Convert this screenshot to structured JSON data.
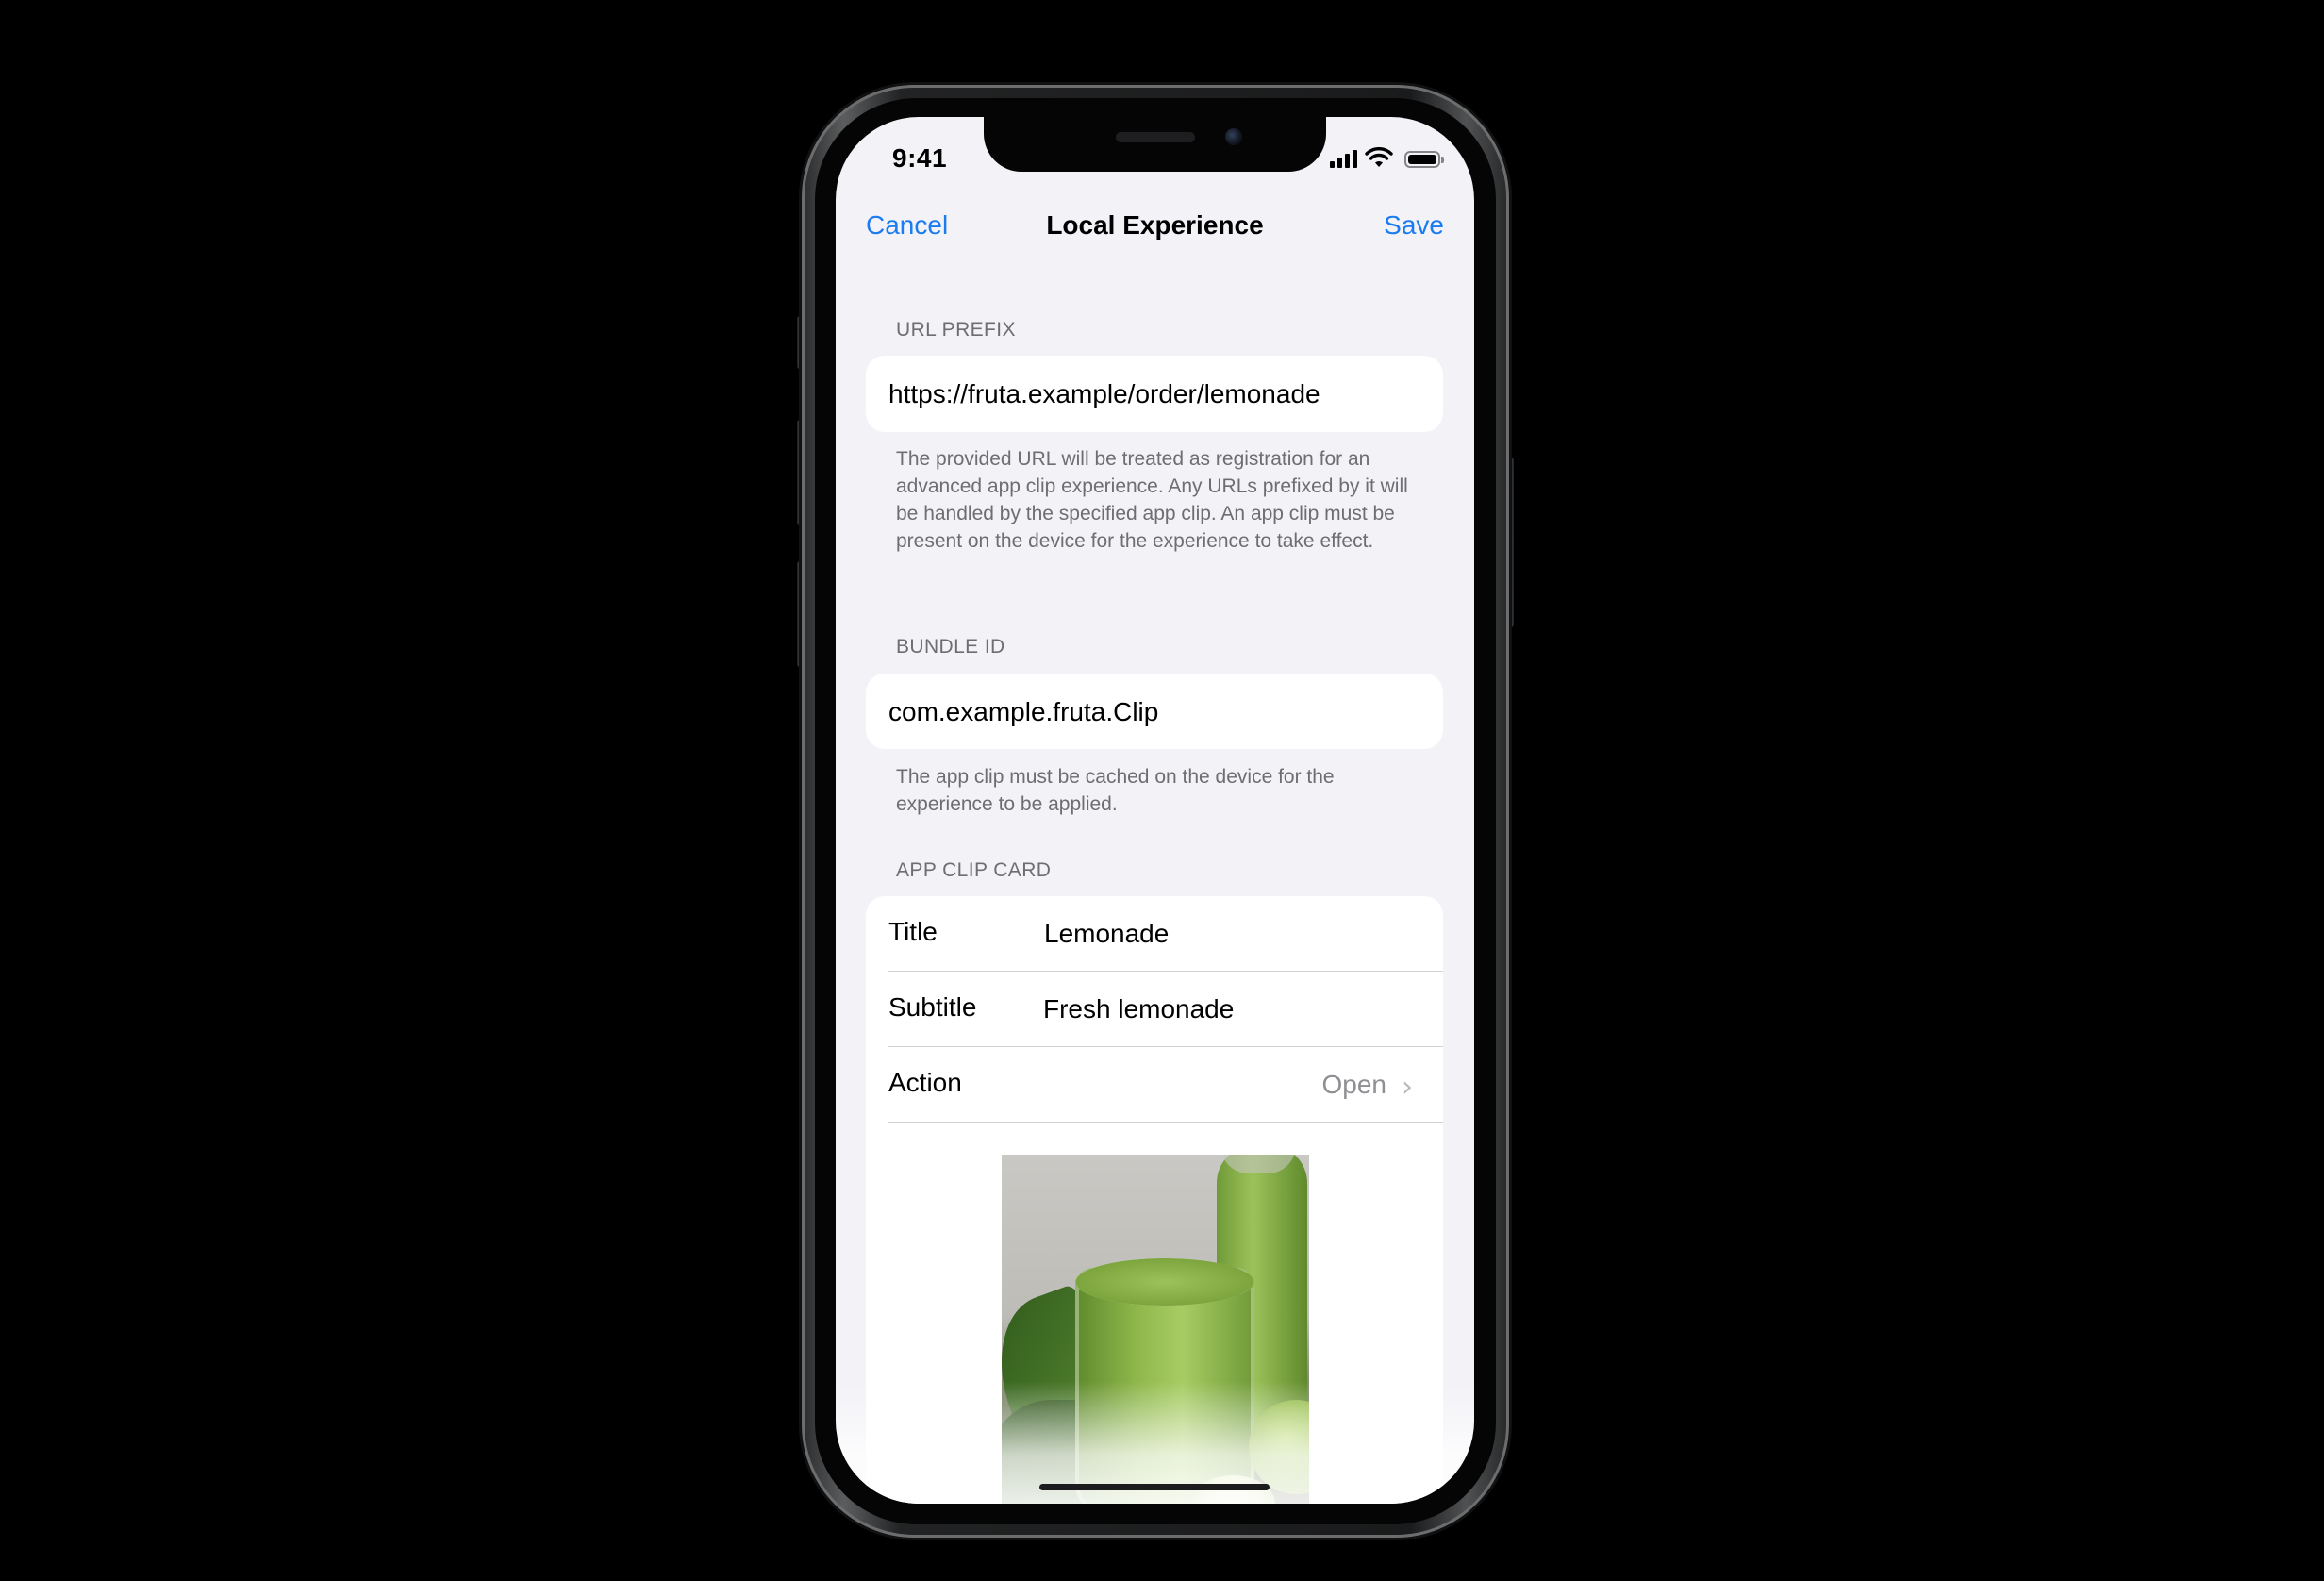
{
  "status_bar": {
    "time": "9:41"
  },
  "nav": {
    "cancel_label": "Cancel",
    "title": "Local Experience",
    "save_label": "Save"
  },
  "url_prefix": {
    "header": "URL PREFIX",
    "value": "https://fruta.example/order/lemonade",
    "footer": "The provided URL will be treated as registration for an advanced app clip experience. Any URLs prefixed by it will be handled by the specified app clip. An app clip must be present on the device for the experience to take effect."
  },
  "bundle_id": {
    "header": "BUNDLE ID",
    "value": "com.example.fruta.Clip",
    "footer": "The app clip must be cached on the device for the experience to be applied."
  },
  "app_clip_card": {
    "header": "APP CLIP CARD",
    "title_label": "Title",
    "title_value": "Lemonade",
    "subtitle_label": "Subtitle",
    "subtitle_value": "Fresh lemonade",
    "action_label": "Action",
    "action_value": "Open"
  },
  "colors": {
    "accent": "#1a7cf0",
    "background": "#f2f2f7",
    "secondary_text": "#6d6d72"
  },
  "icons": [
    "cellular-signal-icon",
    "wifi-icon",
    "battery-icon",
    "chevron-right-icon"
  ]
}
